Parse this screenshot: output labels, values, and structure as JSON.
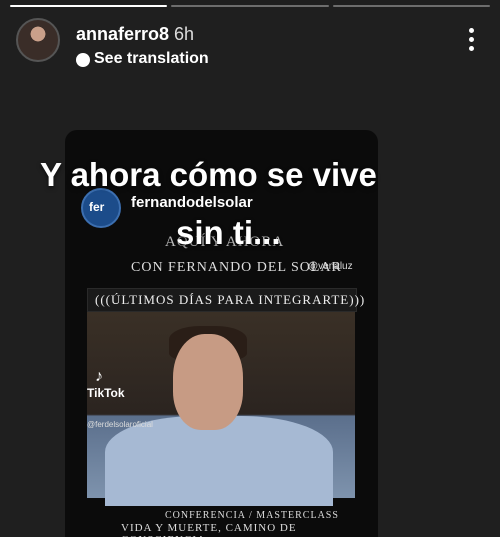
{
  "story": {
    "progress_segments": 3,
    "active_segment": 0,
    "username": "annaferro8",
    "time": "6h",
    "translate_label": "See translation",
    "caption_line1": "Y ahora cómo se vive",
    "caption_line2": "sin ti..."
  },
  "video": {
    "avatar_text": "fer",
    "account": "fernandodelsolar",
    "line_aqui": "AQUÍ Y AHORA",
    "line_con": "CON FERNANDO DEL SOLAR",
    "handle": "@venaluz",
    "banner": "(((ÚLTIMOS DÍAS PARA INTEGRARTE)))",
    "tiktok_label": "TikTok",
    "tiktok_handle": "@ferdelsolaroficial",
    "conference": "CONFERENCIA / MASTERCLASS",
    "subtitle": "VIDA Y MUERTE, CAMINO DE CONSCIENCIA"
  },
  "icons": {
    "more": "more-vertical-icon",
    "translate": "translate-icon",
    "tiktok": "tiktok-icon"
  }
}
